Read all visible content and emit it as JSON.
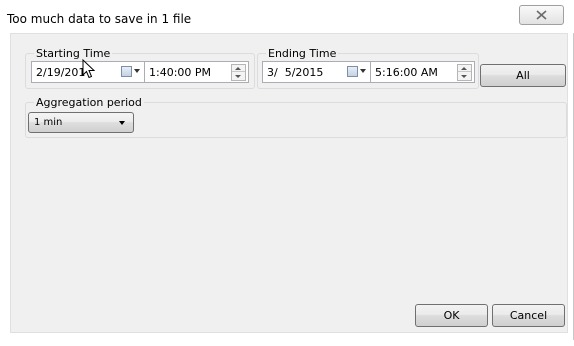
{
  "window": {
    "title": "Too much data to save in 1 file"
  },
  "starting_time": {
    "label": "Starting Time",
    "date": "2/19/201",
    "time": "1:40:00 PM"
  },
  "ending_time": {
    "label": "Ending Time",
    "date": "3/  5/2015",
    "time": "5:16:00 AM"
  },
  "all_button": {
    "label": "All"
  },
  "aggregation": {
    "label": "Aggregation period",
    "selected": "1 min"
  },
  "footer": {
    "ok_label": "OK",
    "cancel_label": "Cancel"
  },
  "icons": {
    "close": "close-icon",
    "calendar": "calendar-icon",
    "spinner": "spinner-icon",
    "dropdown": "chevron-down-icon",
    "cursor": "mouse-pointer-icon"
  },
  "colors": {
    "client_background": "#f0f0f0",
    "window_background": "#ffffff",
    "field_border": "#abadb3"
  }
}
